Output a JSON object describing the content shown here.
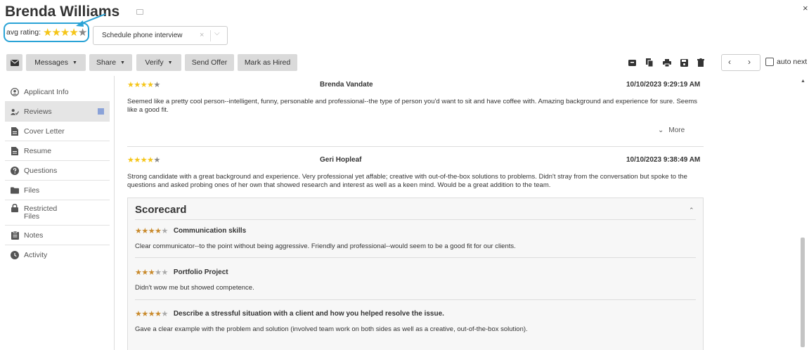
{
  "header": {
    "title": "Brenda Williams",
    "avg_rating_label": "avg rating:",
    "avg_rating_stars": "★★★★",
    "avg_rating_empty": "★",
    "avg_rating_value": 4,
    "schedule_value": "Schedule phone interview",
    "schedule_clear": "×",
    "schedule_chevron": "⌵",
    "close": "×"
  },
  "toolbar": {
    "mail_icon": "mail-icon",
    "messages_label": "Messages",
    "share_label": "Share",
    "verify_label": "Verify",
    "send_offer_label": "Send Offer",
    "mark_hired_label": "Mark as Hired",
    "caret": "▼",
    "prev": "‹",
    "next": "›",
    "auto_next_label": "auto next"
  },
  "sidebar": {
    "items": [
      {
        "label": "Applicant Info",
        "icon": "user-circle-icon"
      },
      {
        "label": "Reviews",
        "icon": "reviews-icon"
      },
      {
        "label": "Cover Letter",
        "icon": "document-icon"
      },
      {
        "label": "Resume",
        "icon": "document-icon"
      },
      {
        "label": "Questions",
        "icon": "question-icon"
      },
      {
        "label": "Files",
        "icon": "folder-icon"
      },
      {
        "label": "Restricted Files",
        "icon": "lock-icon"
      },
      {
        "label": "Notes",
        "icon": "notes-icon"
      },
      {
        "label": "Activity",
        "icon": "clock-icon"
      }
    ]
  },
  "reviews": [
    {
      "stars": "★★★★",
      "empty": "★",
      "rating": 4,
      "reviewer": "Brenda Vandate",
      "timestamp": "10/10/2023 9:29:19 AM",
      "text": "Seemed like a pretty cool person--intelligent, funny, personable and professional--the type of person you'd want to sit and have coffee with. Amazing background and experience for sure. Seems like a good fit.",
      "more_label": "More",
      "more_chevron": "⌄"
    },
    {
      "stars": "★★★★",
      "empty": "★",
      "rating": 4,
      "reviewer": "Geri Hopleaf",
      "timestamp": "10/10/2023 9:38:49 AM",
      "text": "Strong candidate with a great background and experience. Very professional yet affable; creative with out-of-the-box solutions to problems. Didn't stray from the conversation but spoke to the questions and asked probing ones of her own that showed research and interest as well as a keen mind. Would be a great addition to the team."
    }
  ],
  "scorecard": {
    "title": "Scorecard",
    "chevron": "⌃",
    "items": [
      {
        "stars": "★★★★",
        "empty": "★",
        "rating": 4,
        "title": "Communication skills",
        "text": "Clear communicator--to the point without being aggressive. Friendly and professional--would seem to be a good fit for our clients."
      },
      {
        "stars": "★★★",
        "empty": "★★",
        "rating": 3,
        "title": "Portfolio Project",
        "text": "Didn't wow me but showed competence."
      },
      {
        "stars": "★★★★",
        "empty": "★",
        "rating": 4,
        "title": "Describe a stressful situation with a client and how you helped resolve the issue.",
        "text": "Gave a clear example with the problem and solution (involved team work on both sides as well as a creative, out-of-the-box solution)."
      }
    ]
  },
  "colors": {
    "highlight": "#2aa3d6",
    "star_gold": "#f5c518",
    "star_orange": "#c98a2c",
    "button_bg": "#dadada",
    "reviews_badge": "#8aa2d8"
  }
}
